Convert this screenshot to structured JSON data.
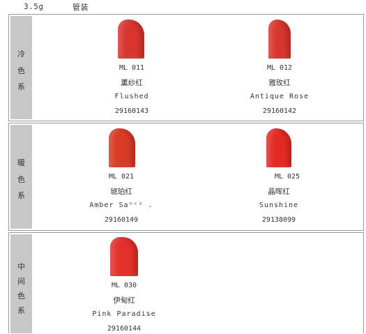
{
  "header": {
    "weight": "3.5g",
    "packaging": "管装"
  },
  "sections": [
    {
      "side_label": [
        "冷",
        "色",
        "系"
      ],
      "items": [
        {
          "code": "ML 011",
          "name_cn": "薰纱红",
          "name_en": "Flushed",
          "sku": "29160143",
          "color": "#d9352f"
        },
        {
          "code": "ML 012",
          "name_cn": "雅玫红",
          "name_en": "Antique Rose",
          "sku": "29160142",
          "color": "#d8362c"
        }
      ]
    },
    {
      "side_label": [
        "暖",
        "色",
        "系"
      ],
      "items": [
        {
          "code": "ML 021",
          "name_cn": "琥珀红",
          "name_en": "Amber Saⁿᶜˣ .",
          "sku": "29160149",
          "color": "#d93b25"
        },
        {
          "code": "ML 025",
          "name_cn": "晶晖红",
          "name_en": "Sunshine",
          "sku": "29138099",
          "color": "#e32b24"
        }
      ]
    },
    {
      "side_label": [
        "中",
        "间",
        "色",
        "系"
      ],
      "items": [
        {
          "code": "ML 030",
          "name_cn": "伊甸红",
          "name_en": "Pink Paradise",
          "sku": "29160144",
          "color": "#e3302b"
        }
      ]
    }
  ]
}
